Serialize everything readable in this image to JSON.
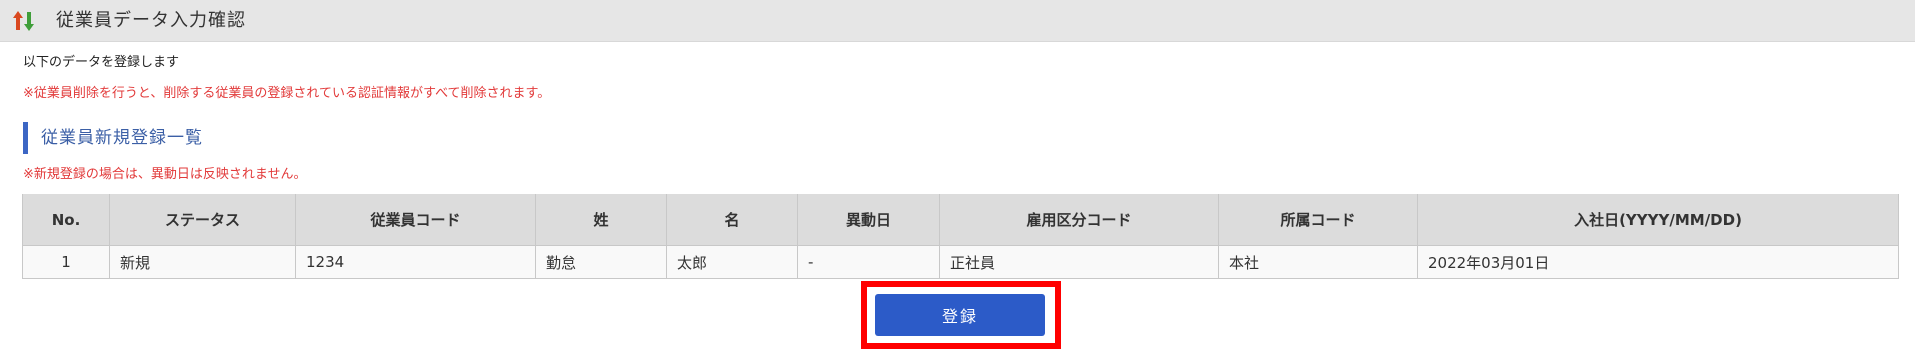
{
  "header": {
    "title": "従業員データ入力確認",
    "icon": "sort-arrows-icon",
    "icon_colors": {
      "up": "#d9481f",
      "down": "#3f9e39"
    }
  },
  "intro": "以下のデータを登録します",
  "warning": "※従業員削除を行うと、削除する従業員の登録されている認証情報がすべて削除されます。",
  "section": {
    "title": "従業員新規登録一覧",
    "note": "※新規登録の場合は、異動日は反映されません。"
  },
  "table": {
    "headers": [
      "No.",
      "ステータス",
      "従業員コード",
      "姓",
      "名",
      "異動日",
      "雇用区分コード",
      "所属コード",
      "入社日(YYYY/MM/DD)"
    ],
    "rows": [
      [
        "1",
        "新規",
        "1234",
        "勤怠",
        "太郎",
        "-",
        "正社員",
        "本社",
        "2022年03月01日"
      ]
    ]
  },
  "submit_label": "登録",
  "colors": {
    "accent": "#2c5bc8",
    "warning": "#e23a3a",
    "highlight": "#ff0000",
    "section_bar": "#3c66c4"
  }
}
